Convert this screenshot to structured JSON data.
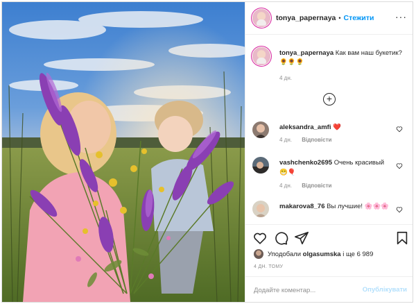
{
  "post": {
    "author": "tonya_papernaya",
    "follow_label": "Стежити",
    "dot": "•",
    "more": "···"
  },
  "caption": {
    "author": "tonya_papernaya",
    "text": "Как вам наш букетик? 🌻🌻🌻",
    "time": "4 дн."
  },
  "comments": [
    {
      "author": "aleksandra_amfi",
      "text": "❤️",
      "time": "4 дн.",
      "reply": "Відповісти"
    },
    {
      "author": "vashchenko2695",
      "text": "Очень красивый 😁🎈",
      "time": "4 дн.",
      "reply": "Відповісти"
    },
    {
      "author": "makarova8_76",
      "text": "Вы лучшие! 🌸🌸🌸",
      "time": "",
      "reply": ""
    }
  ],
  "likes": {
    "prefix": "Уподобали",
    "user": "olgasumska",
    "suffix": "і ще 6 989"
  },
  "post_time": "4 ДН. ТОМУ",
  "add_comment": {
    "placeholder": "Додайте коментар...",
    "publish_label": "Опублікувати"
  },
  "icons": {
    "like": "heart-icon",
    "comment": "comment-bubble-icon",
    "share": "paper-plane-icon",
    "save": "bookmark-icon",
    "load_more": "plus-circle-icon",
    "more": "ellipsis-icon"
  },
  "colors": {
    "accent": "#0095f6",
    "publish_disabled": "#b2dffc",
    "muted": "#8e8e8e",
    "heart_red": "#ed4956"
  }
}
